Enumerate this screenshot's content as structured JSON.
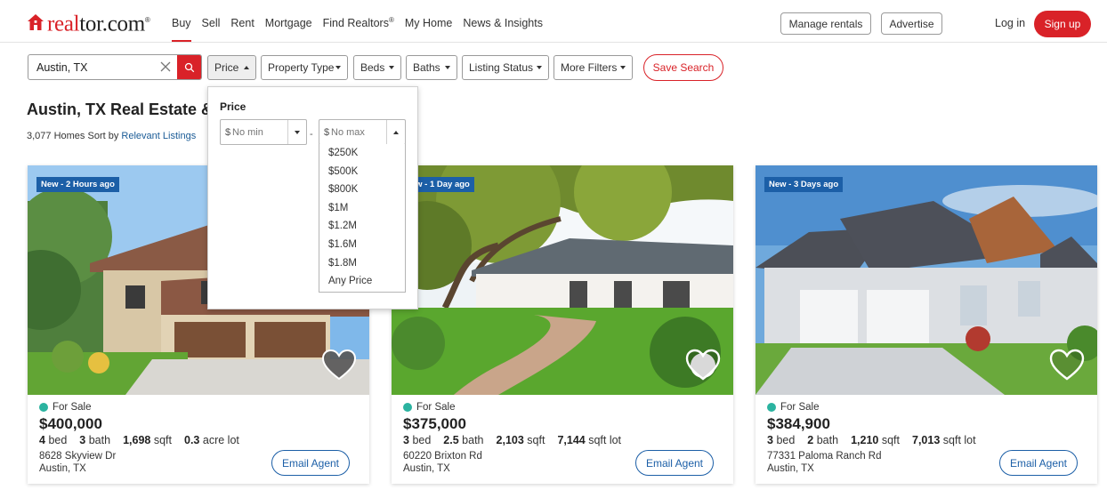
{
  "brand": {
    "name_accent": "real",
    "name_rest": "tor.com",
    "mark": "®",
    "color": "#d92228"
  },
  "nav": {
    "links": [
      "Buy",
      "Sell",
      "Rent",
      "Mortgage",
      "Find Realtors",
      "My Home",
      "News & Insights"
    ],
    "find_realtors_mark": "®",
    "active": "Buy",
    "manage_rentals": "Manage rentals",
    "advertise": "Advertise",
    "login": "Log in",
    "signup": "Sign up"
  },
  "search": {
    "value": "Austin, TX"
  },
  "filters": {
    "price": "Price",
    "property_type": "Property Type",
    "beds": "Beds",
    "baths": "Baths",
    "listing_status": "Listing Status",
    "more_filters": "More Filters",
    "save_search": "Save Search"
  },
  "page": {
    "title": "Austin, TX Real Estate & H",
    "count": "3,077 Homes",
    "sort_prefix": "Sort by",
    "sort_value": "Relevant Listings"
  },
  "price_dropdown": {
    "title": "Price",
    "currency": "$",
    "min_placeholder": "No min",
    "max_placeholder": "No max",
    "dash": "-",
    "options": [
      "$250K",
      "$500K",
      "$800K",
      "$1M",
      "$1.2M",
      "$1.6M",
      "$1.8M",
      "Any Price"
    ]
  },
  "listings": [
    {
      "badge": "New - 2 Hours ago",
      "status": "For Sale",
      "price": "$400,000",
      "beds": "4",
      "beds_label": "bed",
      "baths": "3",
      "baths_label": "bath",
      "sqft": "1,698",
      "sqft_label": "sqft",
      "lot": "0.3",
      "lot_label": "acre lot",
      "street": "8628 Skyview Dr",
      "city": "Austin, TX",
      "cta": "Email Agent",
      "favorited": true
    },
    {
      "badge": "New - 1 Day ago",
      "status": "For Sale",
      "price": "$375,000",
      "beds": "3",
      "beds_label": "bed",
      "baths": "2.5",
      "baths_label": "bath",
      "sqft": "2,103",
      "sqft_label": "sqft",
      "lot": "7,144",
      "lot_label": "sqft lot",
      "street": "60220 Brixton Rd",
      "city": "Austin, TX",
      "cta": "Email Agent",
      "favorited": false
    },
    {
      "badge": "New - 3 Days ago",
      "status": "For Sale",
      "price": "$384,900",
      "beds": "3",
      "beds_label": "bed",
      "baths": "2",
      "baths_label": "bath",
      "sqft": "1,210",
      "sqft_label": "sqft",
      "lot": "7,013",
      "lot_label": "sqft lot",
      "street": "77331 Paloma Ranch Rd",
      "city": "Austin, TX",
      "cta": "Email Agent",
      "favorited": false
    }
  ],
  "colors": {
    "accent": "#d92228",
    "badge": "#1c5fa7",
    "status_dot": "#2bb3a0",
    "link": "#1a5b96"
  }
}
